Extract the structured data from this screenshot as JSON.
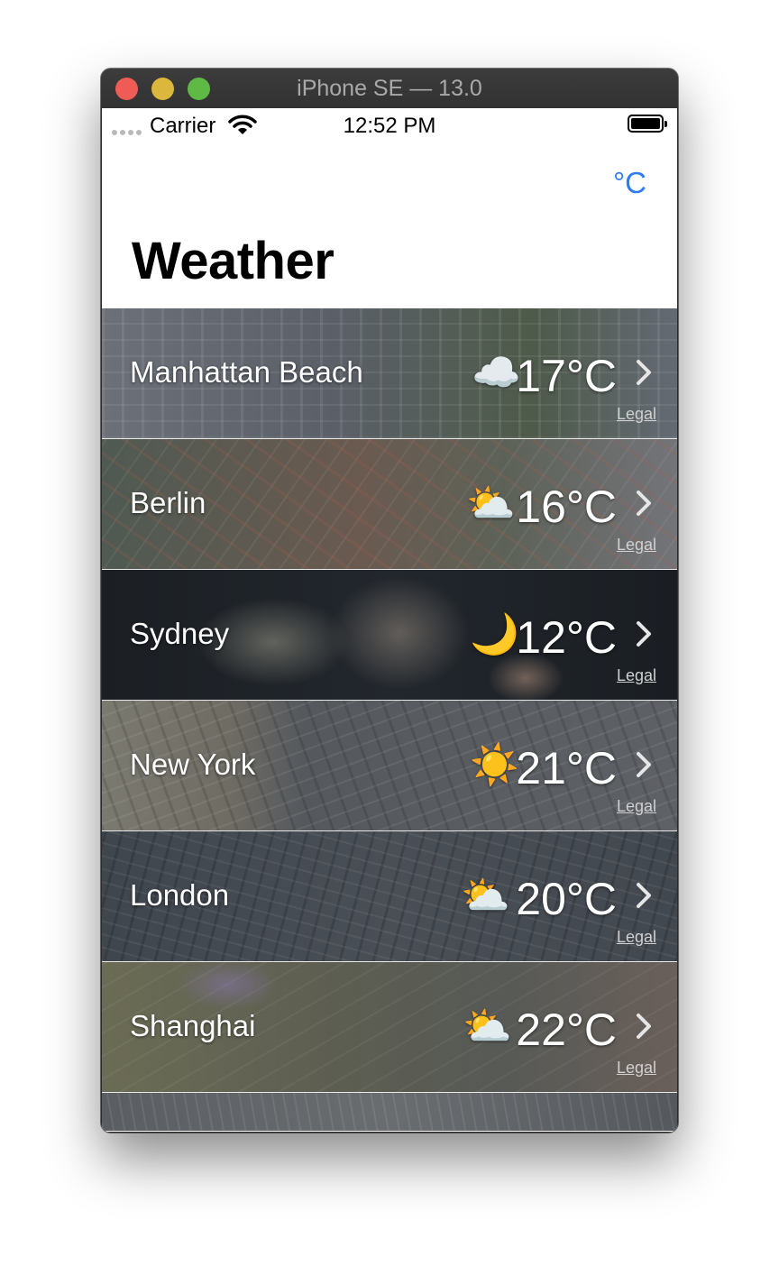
{
  "window": {
    "title": "iPhone SE — 13.0"
  },
  "status_bar": {
    "carrier": "Carrier",
    "time": "12:52 PM"
  },
  "nav": {
    "unit_toggle_label": "°C",
    "title": "Weather"
  },
  "cities": [
    {
      "name": "Manhattan Beach",
      "condition_icon": "cloud-icon",
      "emoji": "☁️",
      "temperature": "17°C",
      "legal": "Legal"
    },
    {
      "name": "Berlin",
      "condition_icon": "partly-cloudy-icon",
      "emoji": "⛅",
      "temperature": "16°C",
      "legal": "Legal"
    },
    {
      "name": "Sydney",
      "condition_icon": "moon-icon",
      "emoji": "🌙",
      "temperature": "12°C",
      "legal": "Legal"
    },
    {
      "name": "New York",
      "condition_icon": "sun-icon",
      "emoji": "☀️",
      "temperature": "21°C",
      "legal": "Legal"
    },
    {
      "name": "London",
      "condition_icon": "partly-cloudy-icon",
      "emoji": "⛅",
      "temperature": "20°C",
      "legal": "Legal"
    },
    {
      "name": "Shanghai",
      "condition_icon": "partly-cloudy-icon",
      "emoji": "⛅",
      "temperature": "22°C",
      "legal": "Legal"
    }
  ],
  "colors": {
    "accent": "#2f7bf5"
  }
}
